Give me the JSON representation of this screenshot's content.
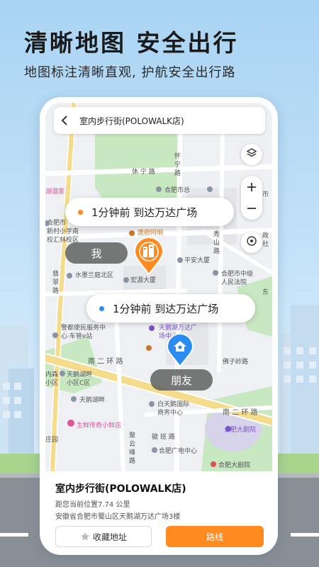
{
  "promo": {
    "headline": "清晰地图 安全出行",
    "subline": "地图标注清晰直观, 护航安全出行路"
  },
  "search": {
    "query": "室内步行街(POLOWALK店)"
  },
  "map_labels": {
    "l1": "怀",
    "l2": "宁",
    "l3": "路",
    "xiuning": "休 宁 路",
    "hefei_city": "合肥市总",
    "shi_gong": "市",
    "gong": "工",
    "chang": "场",
    "hotel": "湖酒家",
    "school1": "合肥市",
    "school2": "新村小学南",
    "school3": "校汇林校区",
    "tangfu": "唐府阿明",
    "shili": "山",
    "xiu": "秀",
    "shan": "山",
    "lu": "路",
    "xunyu": "巡路",
    "chang2": "长",
    "pingan": "平安大厦",
    "hongyuan": "宏源大厦",
    "shuixiang": "水墨兰庭北区",
    "zhongji": "合肥市中级",
    "renmin": "人民法院",
    "qian": "翡",
    "cui": "翠",
    "lu2": "路",
    "jingdu": "警都便民服务中",
    "center": "心·车管e站",
    "tianehu_wanda": "天鹅湖万达广",
    "changzhongxin": "场中心",
    "nan_er": "南 二 环 路",
    "fozi": "佛子岭路",
    "tianehu_xiaoqu1": "天鹅湖畔",
    "tianehu_xiaoqu2": "小区C区",
    "neihu": "内森",
    "xiaoqu": "小区",
    "tianepan": "天鹅湖畔",
    "baitiane": "白天鹅国际",
    "shangwu": "商务中心",
    "nan_er2": "南 二 环 路",
    "fresh": "生鲜传奇小鲜店",
    "zhuang": "庄园",
    "juyun": "聚",
    "yun": "云",
    "feng": "峰",
    "lu3": "路",
    "huai_ban": "徽 班 路",
    "guangdian": "合肥广电中心",
    "hefei_theater": "合肥大剧院",
    "hefei_theater2": "合肥大剧院",
    "dong": "东",
    "shi": "市",
    "zheng": "政",
    "she": "社"
  },
  "bubbles": {
    "top_text": "1分钟前  到达万达广场",
    "bottom_text": "1分钟前  到达万达广场",
    "top_dot_color": "#ff8a1f",
    "bottom_dot_color": "#2a8cf0"
  },
  "tags": {
    "me": "我",
    "friend": "朋友"
  },
  "panel": {
    "name": "室内步行街(POLOWALK店)",
    "distance": "距您当前位置7.74 公里",
    "address": "安徽省合肥市蜀山区天鹅湖万达广场3楼",
    "fav_label": "收藏地址",
    "route_label": "路线"
  },
  "colors": {
    "accent_orange": "#ff8a1f",
    "accent_blue": "#2a8cf0",
    "park_green": "#bfe6b8",
    "road_yellow": "#f5dc8c"
  }
}
